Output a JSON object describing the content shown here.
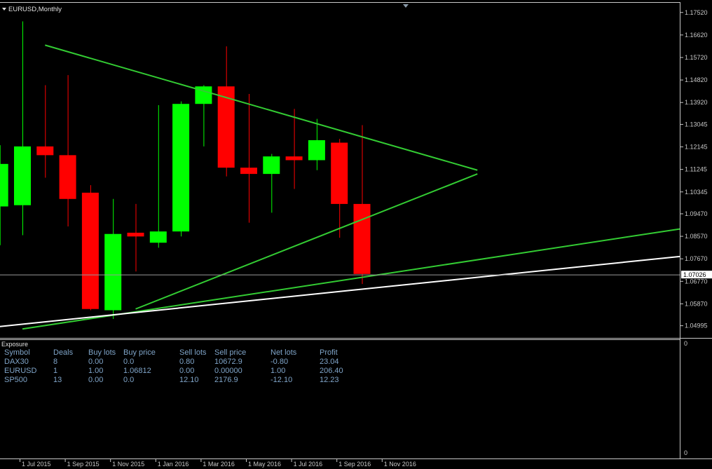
{
  "chart_title": "EURUSD,Monthly",
  "colors": {
    "background": "#000000",
    "bull": "#00ff00",
    "bear": "#ff0000",
    "trendline": "#33cc33",
    "support": "#ffffff",
    "bid_line": "#9a9a9a",
    "panel_text": "#7fa4c8"
  },
  "chart_data": {
    "type": "candlestick",
    "title": "EURUSD,Monthly",
    "timeframe": "Monthly",
    "ylim": [
      1.0455,
      1.1778
    ],
    "y_ticks": [
      "1.17520",
      "1.16620",
      "1.15720",
      "1.14820",
      "1.13920",
      "1.13045",
      "1.12145",
      "1.11245",
      "1.10345",
      "1.09470",
      "1.08570",
      "1.07670",
      "1.06770",
      "1.05870",
      "1.04995"
    ],
    "current_price": "1.07026",
    "x_labels": [
      {
        "label": "1 Jul 2015",
        "index": 1
      },
      {
        "label": "1 Sep 2015",
        "index": 3
      },
      {
        "label": "1 Nov 2015",
        "index": 5
      },
      {
        "label": "1 Jan 2016",
        "index": 7
      },
      {
        "label": "1 Mar 2016",
        "index": 9
      },
      {
        "label": "1 May 2016",
        "index": 11
      },
      {
        "label": "1 Jul 2016",
        "index": 13
      },
      {
        "label": "1 Sep 2016",
        "index": 15
      },
      {
        "label": "1 Nov 2016",
        "index": 17
      }
    ],
    "candles": [
      {
        "open": 1.0975,
        "high": 1.122,
        "low": 1.082,
        "close": 1.1145
      },
      {
        "open": 1.098,
        "high": 1.1715,
        "low": 1.086,
        "close": 1.1215
      },
      {
        "open": 1.1215,
        "high": 1.146,
        "low": 1.109,
        "close": 1.118
      },
      {
        "open": 1.118,
        "high": 1.15,
        "low": 1.0895,
        "close": 1.1005
      },
      {
        "open": 1.103,
        "high": 1.106,
        "low": 1.056,
        "close": 1.0565
      },
      {
        "open": 1.056,
        "high": 1.1005,
        "low": 1.0525,
        "close": 1.0865
      },
      {
        "open": 1.087,
        "high": 1.0985,
        "low": 1.0715,
        "close": 1.0855
      },
      {
        "open": 1.083,
        "high": 1.138,
        "low": 1.081,
        "close": 1.0875
      },
      {
        "open": 1.0875,
        "high": 1.1395,
        "low": 1.0855,
        "close": 1.1385
      },
      {
        "open": 1.1385,
        "high": 1.146,
        "low": 1.1215,
        "close": 1.1455
      },
      {
        "open": 1.1455,
        "high": 1.1615,
        "low": 1.1095,
        "close": 1.113
      },
      {
        "open": 1.113,
        "high": 1.1425,
        "low": 1.091,
        "close": 1.1105
      },
      {
        "open": 1.1105,
        "high": 1.1185,
        "low": 1.095,
        "close": 1.1175
      },
      {
        "open": 1.1175,
        "high": 1.1365,
        "low": 1.1045,
        "close": 1.116
      },
      {
        "open": 1.116,
        "high": 1.1325,
        "low": 1.112,
        "close": 1.124
      },
      {
        "open": 1.123,
        "high": 1.1245,
        "low": 1.085,
        "close": 1.0985
      },
      {
        "open": 1.0985,
        "high": 1.13,
        "low": 1.0665,
        "close": 1.0705
      }
    ],
    "trendlines": [
      {
        "name": "",
        "color": "#33cc33",
        "start": {
          "index": 1,
          "price": 1.162
        },
        "end": {
          "index": 20.1,
          "price": 1.112
        }
      },
      {
        "name": "",
        "color": "#33cc33",
        "start": {
          "index": 5,
          "price": 1.0565
        },
        "end": {
          "index": 20.1,
          "price": 1.1105
        }
      },
      {
        "name": "",
        "color": "#33cc33",
        "start": {
          "index": 0,
          "price": 1.0485
        },
        "end": {
          "index": 29.2,
          "price": 1.0885
        }
      },
      {
        "name": "",
        "color": "#ffffff",
        "start": {
          "index": -1,
          "price": 1.0495
        },
        "end": {
          "index": 29.2,
          "price": 1.0775
        }
      }
    ],
    "indicator_panel": {
      "y_ticks": [
        "0",
        "0"
      ]
    }
  },
  "exposure": {
    "title": "Exposure",
    "columns": [
      "Symbol",
      "Deals",
      "Buy lots",
      "Buy price",
      "Sell lots",
      "Sell price",
      "Net lots",
      "Profit"
    ],
    "rows": [
      [
        "DAX30",
        "8",
        "0.00",
        "0.0",
        "0.80",
        "10672.9",
        "-0.80",
        "23.04"
      ],
      [
        "EURUSD",
        "1",
        "1.00",
        "1.06812",
        "0.00",
        "0.00000",
        "1.00",
        "206.40"
      ],
      [
        "SP500",
        "13",
        "0.00",
        "0.0",
        "12.10",
        "2176.9",
        "-12.10",
        "12.23"
      ]
    ]
  }
}
